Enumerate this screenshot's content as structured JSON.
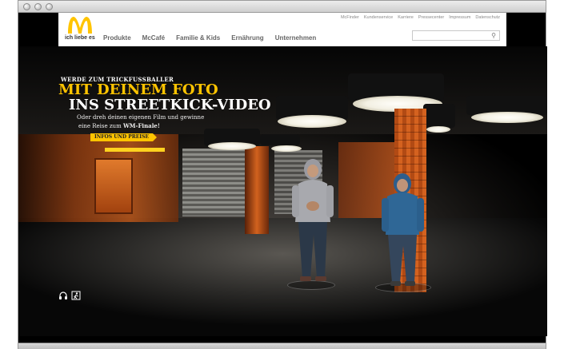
{
  "header": {
    "tagline": "ich liebe es",
    "main_nav": [
      "Produkte",
      "McCafé",
      "Familie & Kids",
      "Ernährung",
      "Unternehmen"
    ],
    "top_nav": [
      "McFinder",
      "Kundenservice",
      "Karriere",
      "Pressecenter",
      "Impressum",
      "Datenschutz"
    ],
    "search": {
      "placeholder": "",
      "value": ""
    }
  },
  "hero": {
    "kicker": "WERDE ZUM TRICKFUSSBALLER",
    "headline_line1": "MIT DEINEM FOTO",
    "headline_line2": "INS STREETKICK-VIDEO",
    "sub_line1": "Oder dreh deinen eigenen Film und gewinne",
    "sub_line2_prefix": "eine Reise zum ",
    "sub_line2_bold": "WM-Finale!",
    "cta_label": "INFOS UND PREISE"
  },
  "controls": {
    "audio_icon": "headphones-icon",
    "exit_icon": "exit-door-icon"
  },
  "colors": {
    "brand_yellow": "#ffc400",
    "logo_red": "#da291c",
    "header_bg": "#ffffff"
  }
}
